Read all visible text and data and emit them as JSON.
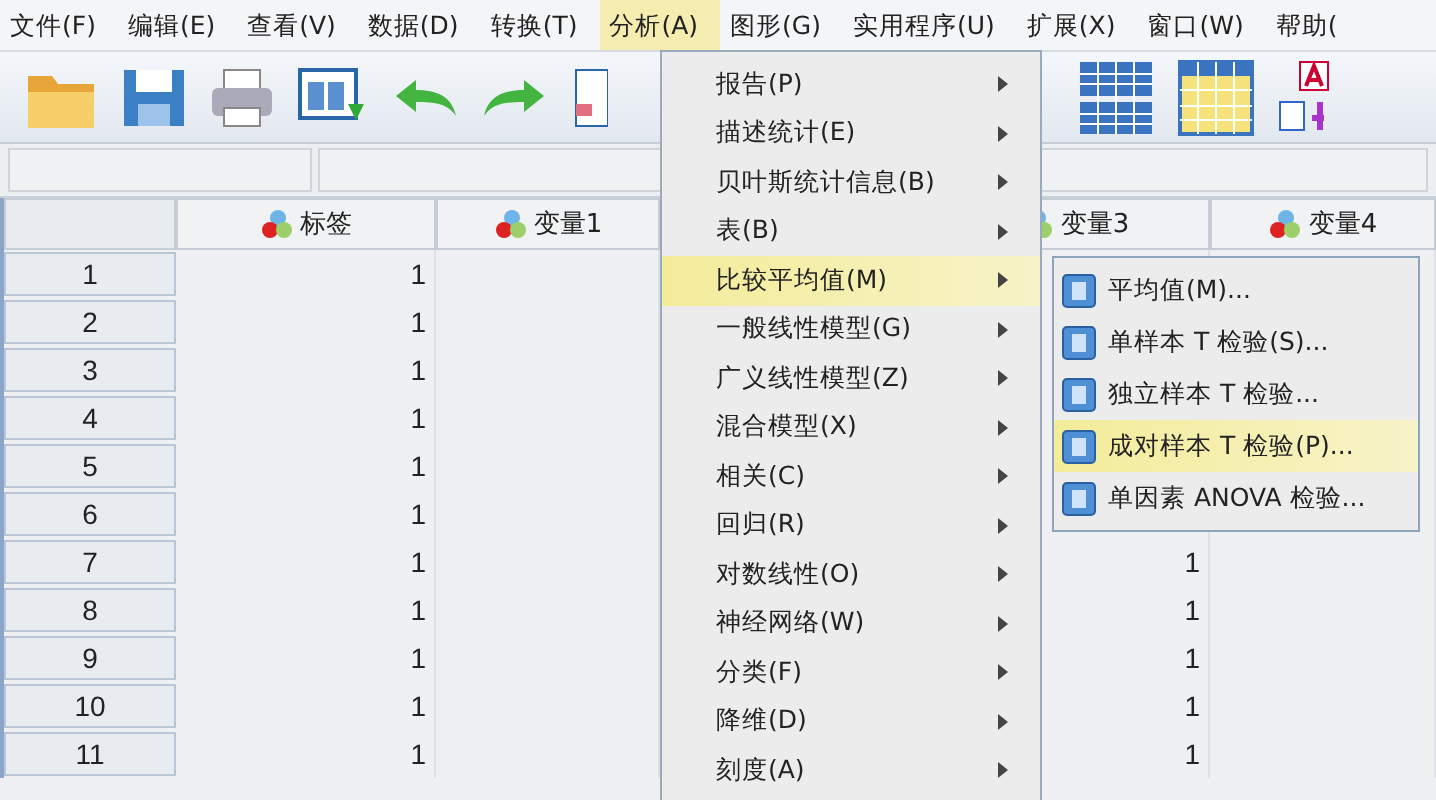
{
  "menu_bar": [
    {
      "label": "文件(F)",
      "selected": false
    },
    {
      "label": "编辑(E)",
      "selected": false
    },
    {
      "label": "查看(V)",
      "selected": false
    },
    {
      "label": "数据(D)",
      "selected": false
    },
    {
      "label": "转换(T)",
      "selected": false
    },
    {
      "label": "分析(A)",
      "selected": true
    },
    {
      "label": "图形(G)",
      "selected": false
    },
    {
      "label": "实用程序(U)",
      "selected": false
    },
    {
      "label": "扩展(X)",
      "selected": false
    },
    {
      "label": "窗口(W)",
      "selected": false
    },
    {
      "label": "帮助(",
      "selected": false
    }
  ],
  "table": {
    "columns": [
      {
        "label": "标签"
      },
      {
        "label": "变量1"
      },
      {
        "label": "变量3"
      },
      {
        "label": "变量4"
      }
    ],
    "rows": [
      {
        "number": "1",
        "cells": [
          "1",
          null,
          null,
          null
        ]
      },
      {
        "number": "2",
        "cells": [
          "1",
          null,
          null,
          null
        ]
      },
      {
        "number": "3",
        "cells": [
          "1",
          null,
          null,
          null
        ]
      },
      {
        "number": "4",
        "cells": [
          "1",
          null,
          null,
          null
        ]
      },
      {
        "number": "5",
        "cells": [
          "1",
          null,
          null,
          null
        ]
      },
      {
        "number": "6",
        "cells": [
          "1",
          null,
          null,
          null
        ]
      },
      {
        "number": "7",
        "cells": [
          "1",
          null,
          "1",
          null
        ]
      },
      {
        "number": "8",
        "cells": [
          "1",
          null,
          "1",
          null
        ]
      },
      {
        "number": "9",
        "cells": [
          "1",
          null,
          "1",
          null
        ]
      },
      {
        "number": "10",
        "cells": [
          "1",
          null,
          "1",
          null
        ]
      },
      {
        "number": "11",
        "cells": [
          "1",
          null,
          "1",
          null
        ]
      }
    ]
  },
  "analyze_menu": {
    "items": [
      {
        "label": "报告(P)",
        "selected": false
      },
      {
        "label": "描述统计(E)",
        "selected": false
      },
      {
        "label": "贝叶斯统计信息(B)",
        "selected": false
      },
      {
        "label": "表(B)",
        "selected": false
      },
      {
        "label": "比较平均值(M)",
        "selected": true
      },
      {
        "label": "一般线性模型(G)",
        "selected": false
      },
      {
        "label": "广义线性模型(Z)",
        "selected": false
      },
      {
        "label": "混合模型(X)",
        "selected": false
      },
      {
        "label": "相关(C)",
        "selected": false
      },
      {
        "label": "回归(R)",
        "selected": false
      },
      {
        "label": "对数线性(O)",
        "selected": false
      },
      {
        "label": "神经网络(W)",
        "selected": false
      },
      {
        "label": "分类(F)",
        "selected": false
      },
      {
        "label": "降维(D)",
        "selected": false
      },
      {
        "label": "刻度(A)",
        "selected": false
      }
    ]
  },
  "compare_means_submenu": {
    "items": [
      {
        "label": "平均值(M)...",
        "selected": false
      },
      {
        "label": "单样本 T 检验(S)...",
        "selected": false
      },
      {
        "label": "独立样本 T 检验...",
        "selected": false
      },
      {
        "label": "成对样本 T 检验(P)...",
        "selected": true
      },
      {
        "label": "单因素 ANOVA 检验...",
        "selected": false
      }
    ]
  }
}
